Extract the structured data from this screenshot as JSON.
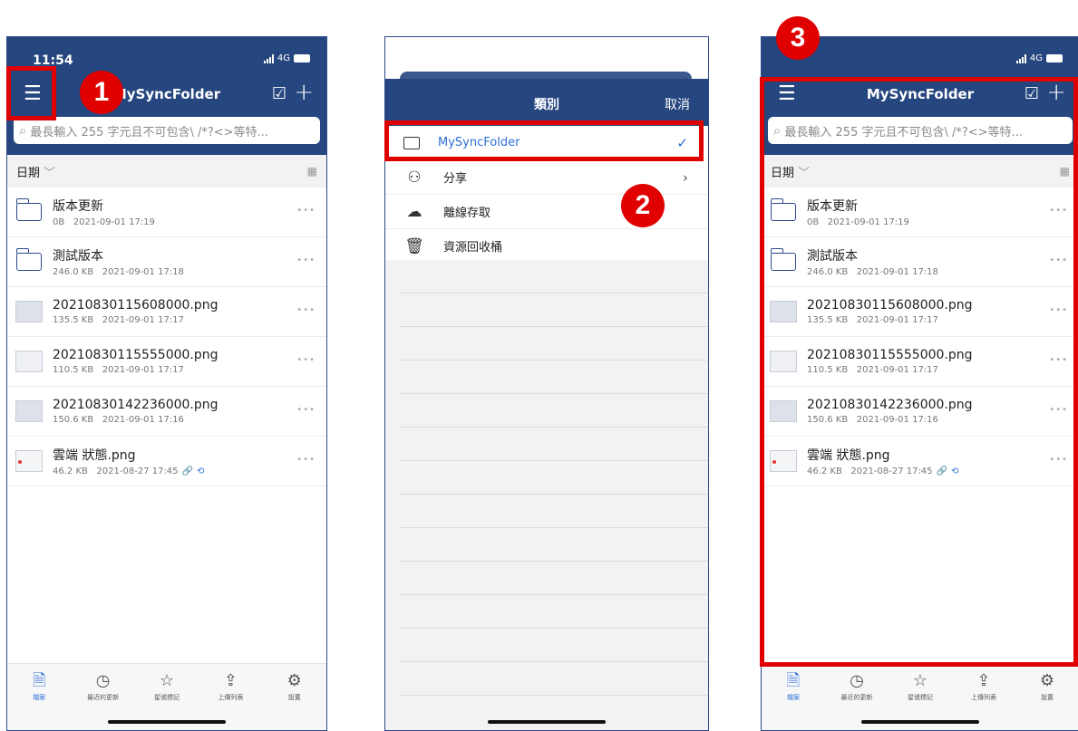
{
  "status": {
    "time": "11:54",
    "network": "4G"
  },
  "header": {
    "title": "MySyncFolder",
    "search_placeholder": "最長輸入 255 字元且不可包含\\ /*?<>等特..."
  },
  "sortbar": {
    "label": "日期"
  },
  "files": [
    {
      "name": "版本更新",
      "size": "0B",
      "date": "2021-09-01 17:19",
      "kind": "folder"
    },
    {
      "name": "測試版本",
      "size": "246.0 KB",
      "date": "2021-09-01 17:18",
      "kind": "folder"
    },
    {
      "name": "20210830115608000.png",
      "size": "135.5 KB",
      "date": "2021-09-01 17:17",
      "kind": "image"
    },
    {
      "name": "20210830115555000.png",
      "size": "110.5 KB",
      "date": "2021-09-01 17:17",
      "kind": "image"
    },
    {
      "name": "20210830142236000.png",
      "size": "150.6 KB",
      "date": "2021-09-01 17:16",
      "kind": "image"
    },
    {
      "name": "雲端 狀態.png",
      "size": "46.2 KB",
      "date": "2021-08-27 17:45",
      "kind": "image",
      "shared": true
    }
  ],
  "tabs": [
    {
      "label": "檔案",
      "icon": "document-icon",
      "active": true
    },
    {
      "label": "最近的更新",
      "icon": "clock-icon"
    },
    {
      "label": "星號標記",
      "icon": "star-icon"
    },
    {
      "label": "上傳列表",
      "icon": "upload-icon"
    },
    {
      "label": "設置",
      "icon": "gear-icon"
    }
  ],
  "category_sheet": {
    "title": "類別",
    "cancel": "取消",
    "items": [
      {
        "label": "MySyncFolder",
        "icon": "device-icon",
        "selected": true
      },
      {
        "label": "分享",
        "icon": "people-icon"
      },
      {
        "label": "離線存取",
        "icon": "cloud-check-icon"
      },
      {
        "label": "資源回收桶",
        "icon": "trash-icon"
      }
    ]
  },
  "badges": [
    "1",
    "2",
    "3"
  ],
  "colors": {
    "header": "#26467f",
    "accent": "#2d6fd8",
    "highlight": "#e00000"
  }
}
